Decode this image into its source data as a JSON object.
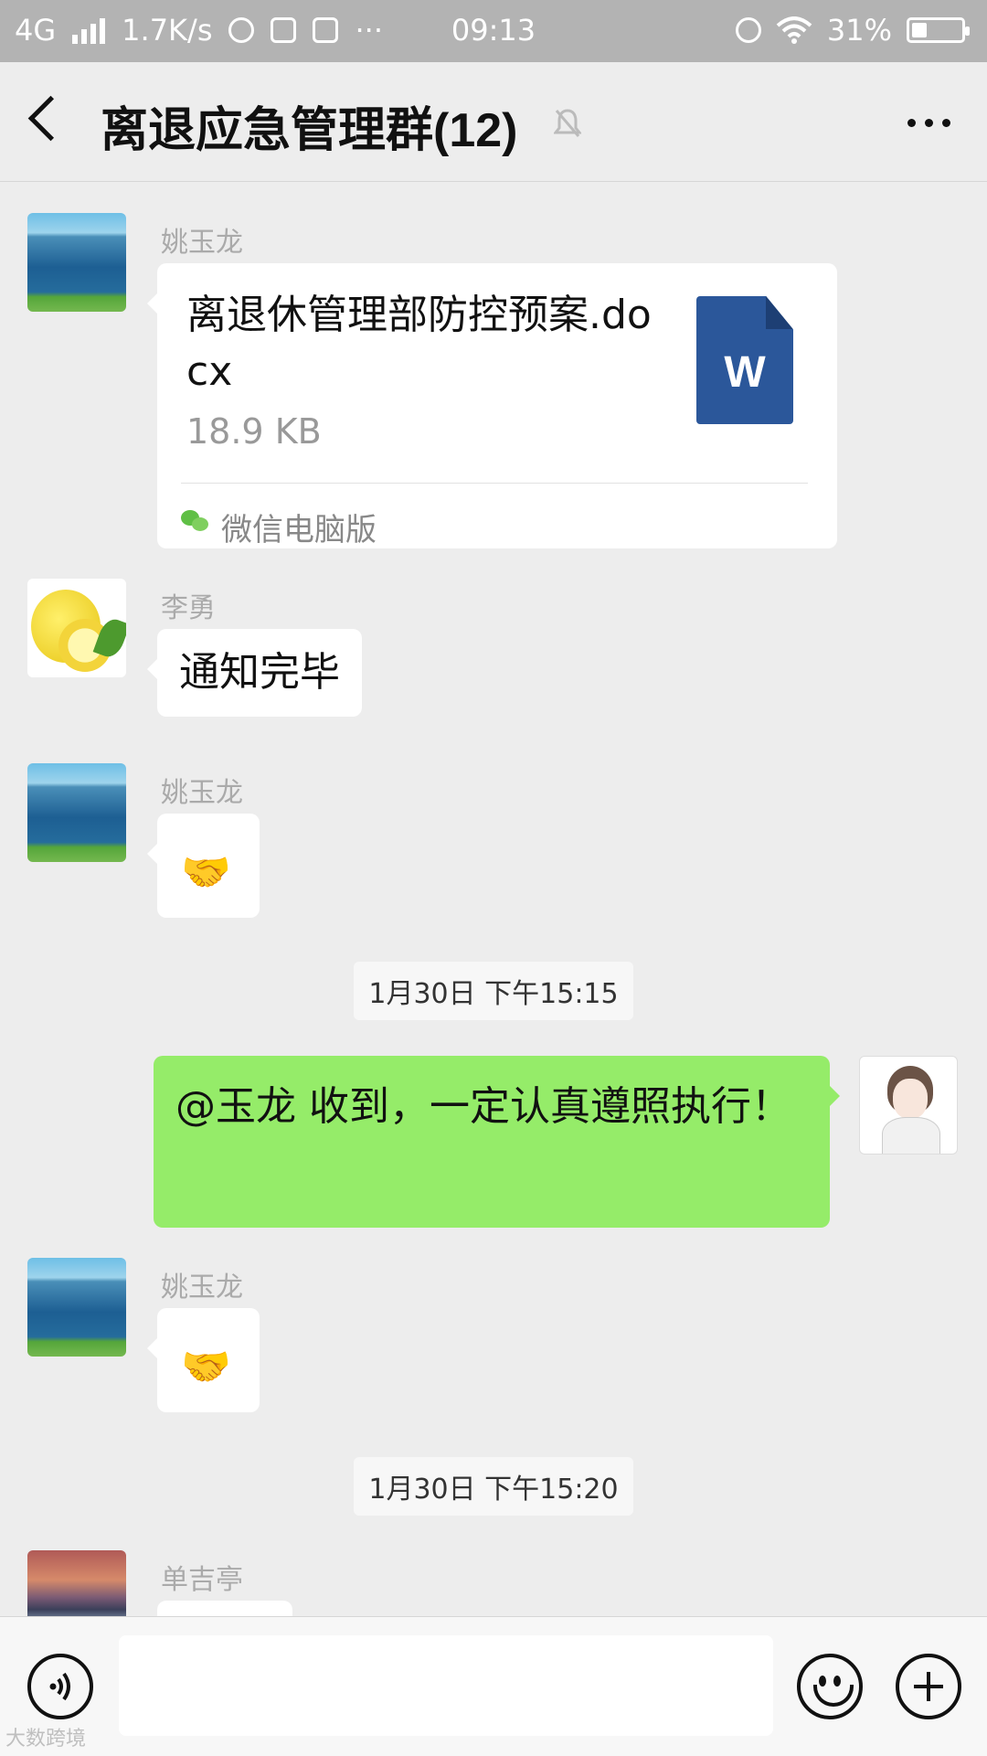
{
  "status_bar": {
    "network": "4G",
    "speed": "1.7K/s",
    "time": "09:13",
    "battery": "31%",
    "battery_level": 0.31
  },
  "header": {
    "title": "离退应急管理群(12)"
  },
  "messages": [
    {
      "sender": "姚玉龙",
      "type": "file",
      "file_name": "离退休管理部防控预案.docx",
      "file_size": "18.9 KB",
      "file_icon_letter": "W",
      "source": "微信电脑版"
    },
    {
      "sender": "李勇",
      "type": "text",
      "text": "通知完毕"
    },
    {
      "sender": "姚玉龙",
      "type": "emoji",
      "emoji": "🤝"
    },
    {
      "type": "time",
      "text": "1月30日 下午15:15"
    },
    {
      "sender": "self",
      "type": "text",
      "text": "@玉龙  收到，一定认真遵照执行！"
    },
    {
      "sender": "姚玉龙",
      "type": "emoji",
      "emoji": "🤝"
    },
    {
      "type": "time",
      "text": "1月30日 下午15:20"
    },
    {
      "sender": "单吉亭",
      "type": "text",
      "text": ""
    }
  ],
  "watermark": "大数跨境",
  "colors": {
    "sent_bubble": "#95ec69",
    "received_bubble": "#ffffff",
    "background": "#ededed",
    "word_blue": "#2b579a"
  }
}
